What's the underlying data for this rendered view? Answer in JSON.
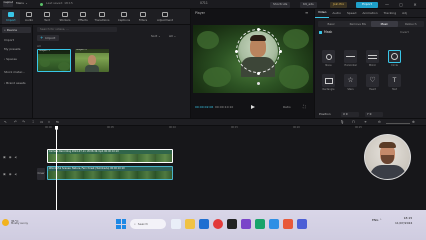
{
  "titlebar": {
    "logo": "CapCut",
    "menu": "Menu ⌄",
    "filename": "Last saved: 18:15",
    "center": "0711",
    "shortcuts": "Shortcuts",
    "user": "K9_ads",
    "pro": "Join Pro",
    "export": "Export",
    "min": "—",
    "max": "▢",
    "close": "✕"
  },
  "tools": [
    {
      "label": "Import"
    },
    {
      "label": "Audio"
    },
    {
      "label": "Text"
    },
    {
      "label": "Stickers"
    },
    {
      "label": "Effects"
    },
    {
      "label": "Transitions"
    },
    {
      "label": "Captions"
    },
    {
      "label": "Filters"
    },
    {
      "label": "Adjustment"
    }
  ],
  "sidebar": {
    "items": [
      "• Device",
      "Import",
      "My presets",
      "› Spaces",
      "Stock mater...",
      "› Brand assets"
    ]
  },
  "media": {
    "search_placeholder": "Search for videos, ...",
    "import": "Import",
    "sort": "Sort ⌄",
    "all": "All ⌄",
    "all_label": "All",
    "clips": [
      {
        "caption": "Subject 1"
      },
      {
        "caption": "Subject 2"
      }
    ]
  },
  "player": {
    "title": "Player",
    "menu": "≡",
    "time_current": "00:00:02:06",
    "time_total": "00:00:10:10",
    "ratio": "Ratio",
    "fullscreen": "⛶"
  },
  "props": {
    "tabs": [
      "Video",
      "Audio",
      "Speed",
      "Animation",
      "Tracking",
      "Adj"
    ],
    "active_tab": "Video",
    "subtabs": [
      "Basic",
      "Remove BG",
      "Mask",
      "Retouch"
    ],
    "active_subtab": "Mask",
    "mask_title": "Mask",
    "invert": "Invert",
    "masks": [
      {
        "label": "None"
      },
      {
        "label": "Horizontal"
      },
      {
        "label": "Mirror"
      },
      {
        "label": "Circle"
      },
      {
        "label": "Rectangle"
      },
      {
        "label": "Stars"
      },
      {
        "label": "Heart"
      },
      {
        "label": "Text"
      }
    ],
    "position_label": "Position",
    "pos_x": "X 0",
    "pos_y": "Y 0"
  },
  "timeline": {
    "ticks": [
      "00:00",
      "00:05",
      "00:10",
      "00:15",
      "00:20",
      "00:25",
      "00:30",
      "00:35",
      "00:40",
      "00:45"
    ],
    "cover": "Cover",
    "clip1_label": "Camera Recording 2024-07-11 18:06:49.mp4  00:00:10:10",
    "clip2_label": "Wonderful Scenes: Nature, Fern forest (Tamilnadu)  00:00:10:10"
  },
  "taskbar": {
    "temp": "31°C",
    "weather": "Mostly sunny",
    "search": "Search",
    "tray": "ENG  ⌃",
    "time": "18:15",
    "date": "11/07/2024"
  }
}
